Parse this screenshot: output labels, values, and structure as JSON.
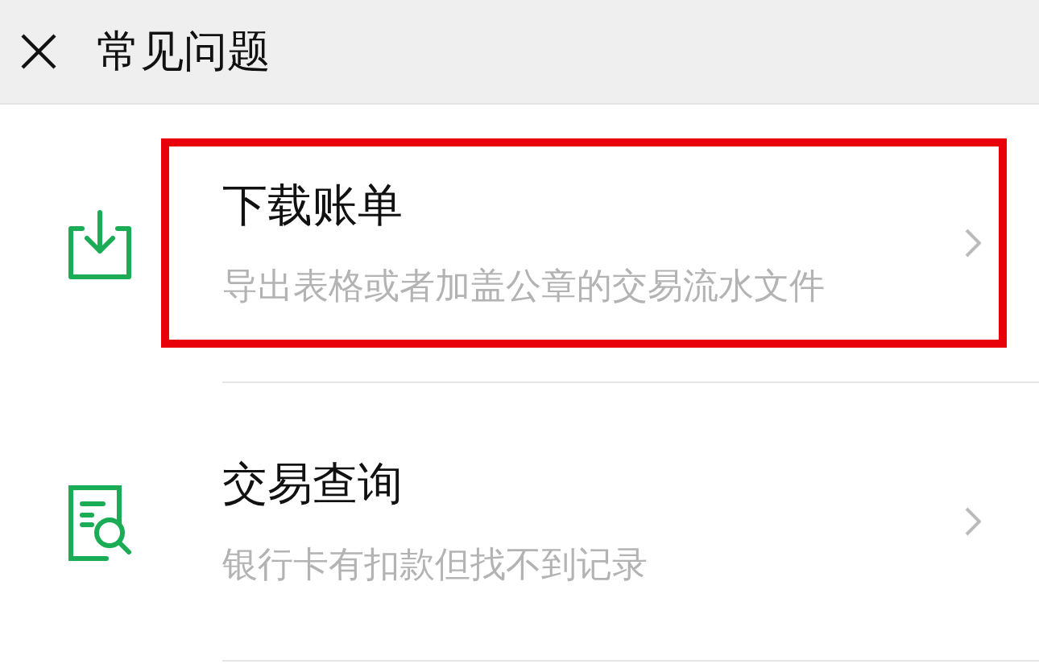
{
  "header": {
    "title": "常见问题"
  },
  "items": [
    {
      "kind": "download",
      "title": "下载账单",
      "subtitle": "导出表格或者加盖公章的交易流水文件",
      "highlighted": true
    },
    {
      "kind": "search",
      "title": "交易查询",
      "subtitle": "银行卡有扣款但找不到记录",
      "highlighted": false
    }
  ]
}
